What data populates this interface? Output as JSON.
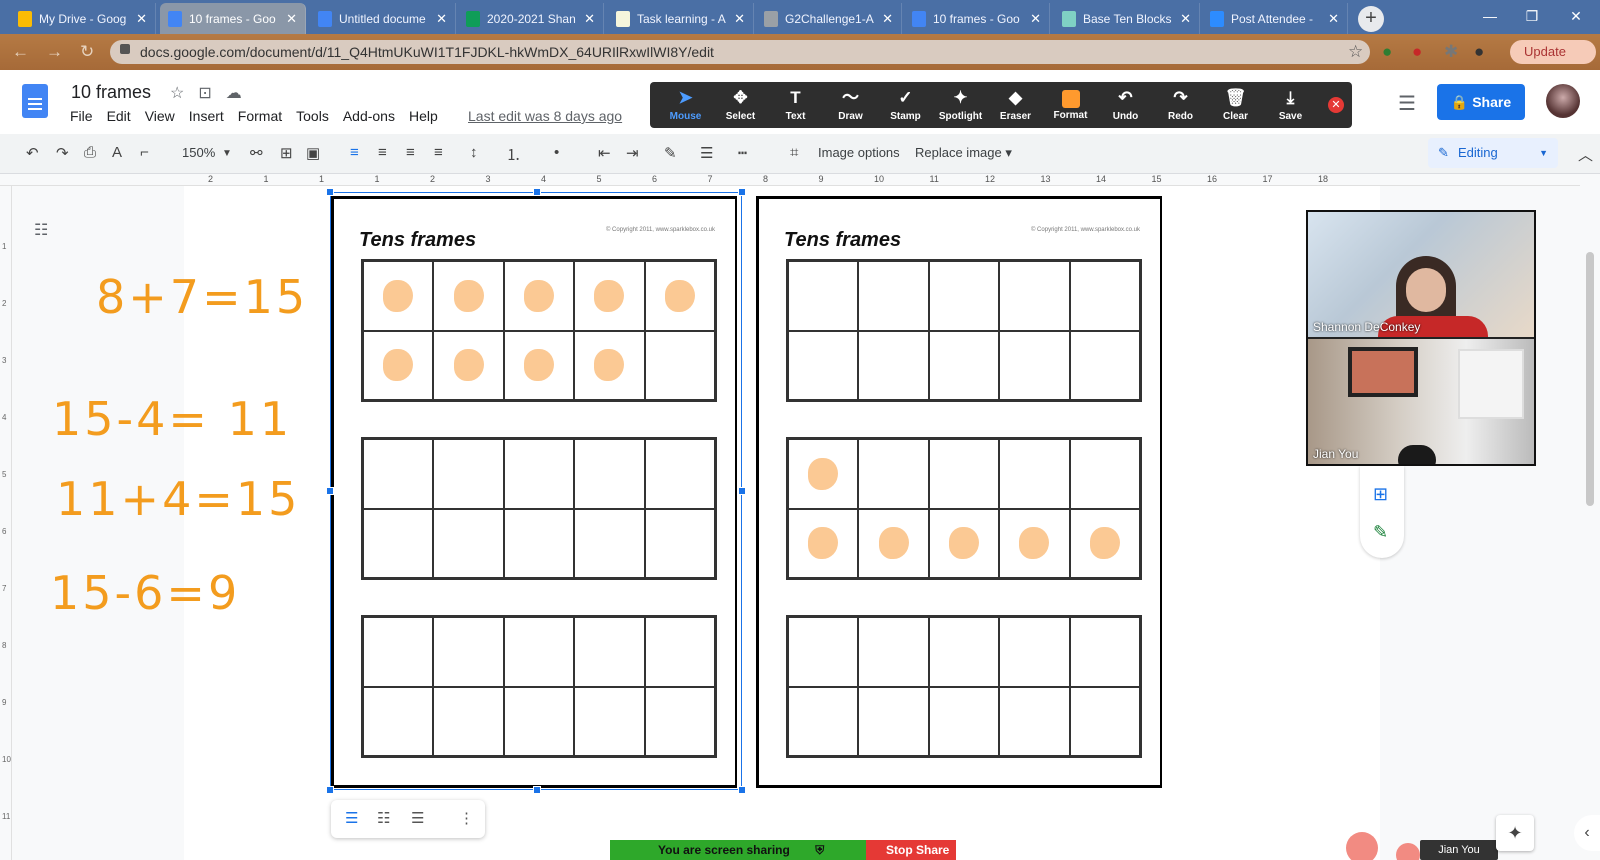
{
  "browser": {
    "tabs": [
      {
        "title": "My Drive - Goog",
        "color": "#fbbc04",
        "active": false
      },
      {
        "title": "10 frames - Goo",
        "color": "#4285f4",
        "active": true
      },
      {
        "title": "Untitled docume",
        "color": "#4285f4",
        "active": false
      },
      {
        "title": "2020-2021 Shan",
        "color": "#0f9d58",
        "active": false
      },
      {
        "title": "Task learning - A",
        "color": "#f5f5dc",
        "active": false
      },
      {
        "title": "G2Challenge1-A",
        "color": "#9aa0a6",
        "active": false
      },
      {
        "title": "10 frames - Goo",
        "color": "#4285f4",
        "active": false
      },
      {
        "title": "Base Ten Blocks",
        "color": "#7fd1c4",
        "active": false
      },
      {
        "title": "Post Attendee -",
        "color": "#2d8cff",
        "active": false
      }
    ],
    "new_tab": "+",
    "url": "docs.google.com/document/d/11_Q4HtmUKuWI1T1FJDKL-hkWmDX_64URIlRxwIlWI8Y/edit",
    "update_label": "Update"
  },
  "docs": {
    "title": "10 frames",
    "menus": [
      "File",
      "Edit",
      "View",
      "Insert",
      "Format",
      "Tools",
      "Add-ons",
      "Help"
    ],
    "last_edit": "Last edit was 8 days ago",
    "share_label": "Share",
    "zoom": "150%",
    "image_options": "Image options",
    "replace_image": "Replace image",
    "editing_label": "Editing"
  },
  "annotate": {
    "tools": [
      {
        "label": "Mouse",
        "glyph": "➤",
        "icon": "mouse-pointer-icon",
        "active": true
      },
      {
        "label": "Select",
        "glyph": "✥",
        "icon": "select-move-icon",
        "active": false
      },
      {
        "label": "Text",
        "glyph": "T",
        "icon": "text-icon",
        "active": false
      },
      {
        "label": "Draw",
        "glyph": "〜",
        "icon": "draw-icon",
        "active": false
      },
      {
        "label": "Stamp",
        "glyph": "✓",
        "icon": "stamp-icon",
        "active": false
      },
      {
        "label": "Spotlight",
        "glyph": "✦",
        "icon": "spotlight-icon",
        "active": false
      },
      {
        "label": "Eraser",
        "glyph": "◆",
        "icon": "eraser-icon",
        "active": false
      },
      {
        "label": "Format",
        "glyph": "",
        "icon": "format-color-icon",
        "active": false
      },
      {
        "label": "Undo",
        "glyph": "↶",
        "icon": "undo-icon",
        "active": false
      },
      {
        "label": "Redo",
        "glyph": "↷",
        "icon": "redo-icon",
        "active": false
      },
      {
        "label": "Clear",
        "glyph": "🗑",
        "icon": "trash-icon",
        "active": false
      },
      {
        "label": "Save",
        "glyph": "⤓",
        "icon": "save-icon",
        "active": false
      }
    ],
    "accent": "#4d9cff"
  },
  "ruler": {
    "h_marks": [
      "2",
      "1",
      "1",
      "1",
      "2",
      "3",
      "4",
      "5",
      "6",
      "7",
      "8",
      "9",
      "10",
      "11",
      "12",
      "13",
      "14",
      "15",
      "16",
      "17",
      "18"
    ],
    "v_marks": [
      "1",
      "2",
      "3",
      "4",
      "5",
      "6",
      "7",
      "8",
      "9",
      "10",
      "11"
    ]
  },
  "handwriting": {
    "color": "#f39c1e",
    "equations": [
      "8+7=15",
      "15-4= 11",
      "11+4=15",
      "15-6=9"
    ]
  },
  "worksheets": [
    {
      "title": "Tens frames",
      "copyright": "© Copyright 2011, www.sparklebox.co.uk",
      "frames": [
        [
          1,
          1,
          1,
          1,
          1,
          1,
          1,
          1,
          1,
          0
        ],
        [
          0,
          0,
          0,
          0,
          0,
          0,
          0,
          0,
          0,
          0
        ],
        [
          0,
          0,
          0,
          0,
          0,
          0,
          0,
          0,
          0,
          0
        ]
      ]
    },
    {
      "title": "Tens frames",
      "copyright": "© Copyright 2011, www.sparklebox.co.uk",
      "frames": [
        [
          0,
          0,
          0,
          0,
          0,
          0,
          0,
          0,
          0,
          0
        ],
        [
          1,
          0,
          0,
          0,
          0,
          1,
          1,
          1,
          1,
          1
        ],
        [
          0,
          0,
          0,
          0,
          0,
          0,
          0,
          0,
          0,
          0
        ]
      ]
    }
  ],
  "dot_color": "#fbc994",
  "video": {
    "participants": [
      {
        "name": "Shannon DeConkey"
      },
      {
        "name": "Jian You"
      }
    ]
  },
  "screenshare": {
    "status": "You are screen sharing",
    "stop_label": "Stop Share"
  },
  "floating_label": "Jian You"
}
